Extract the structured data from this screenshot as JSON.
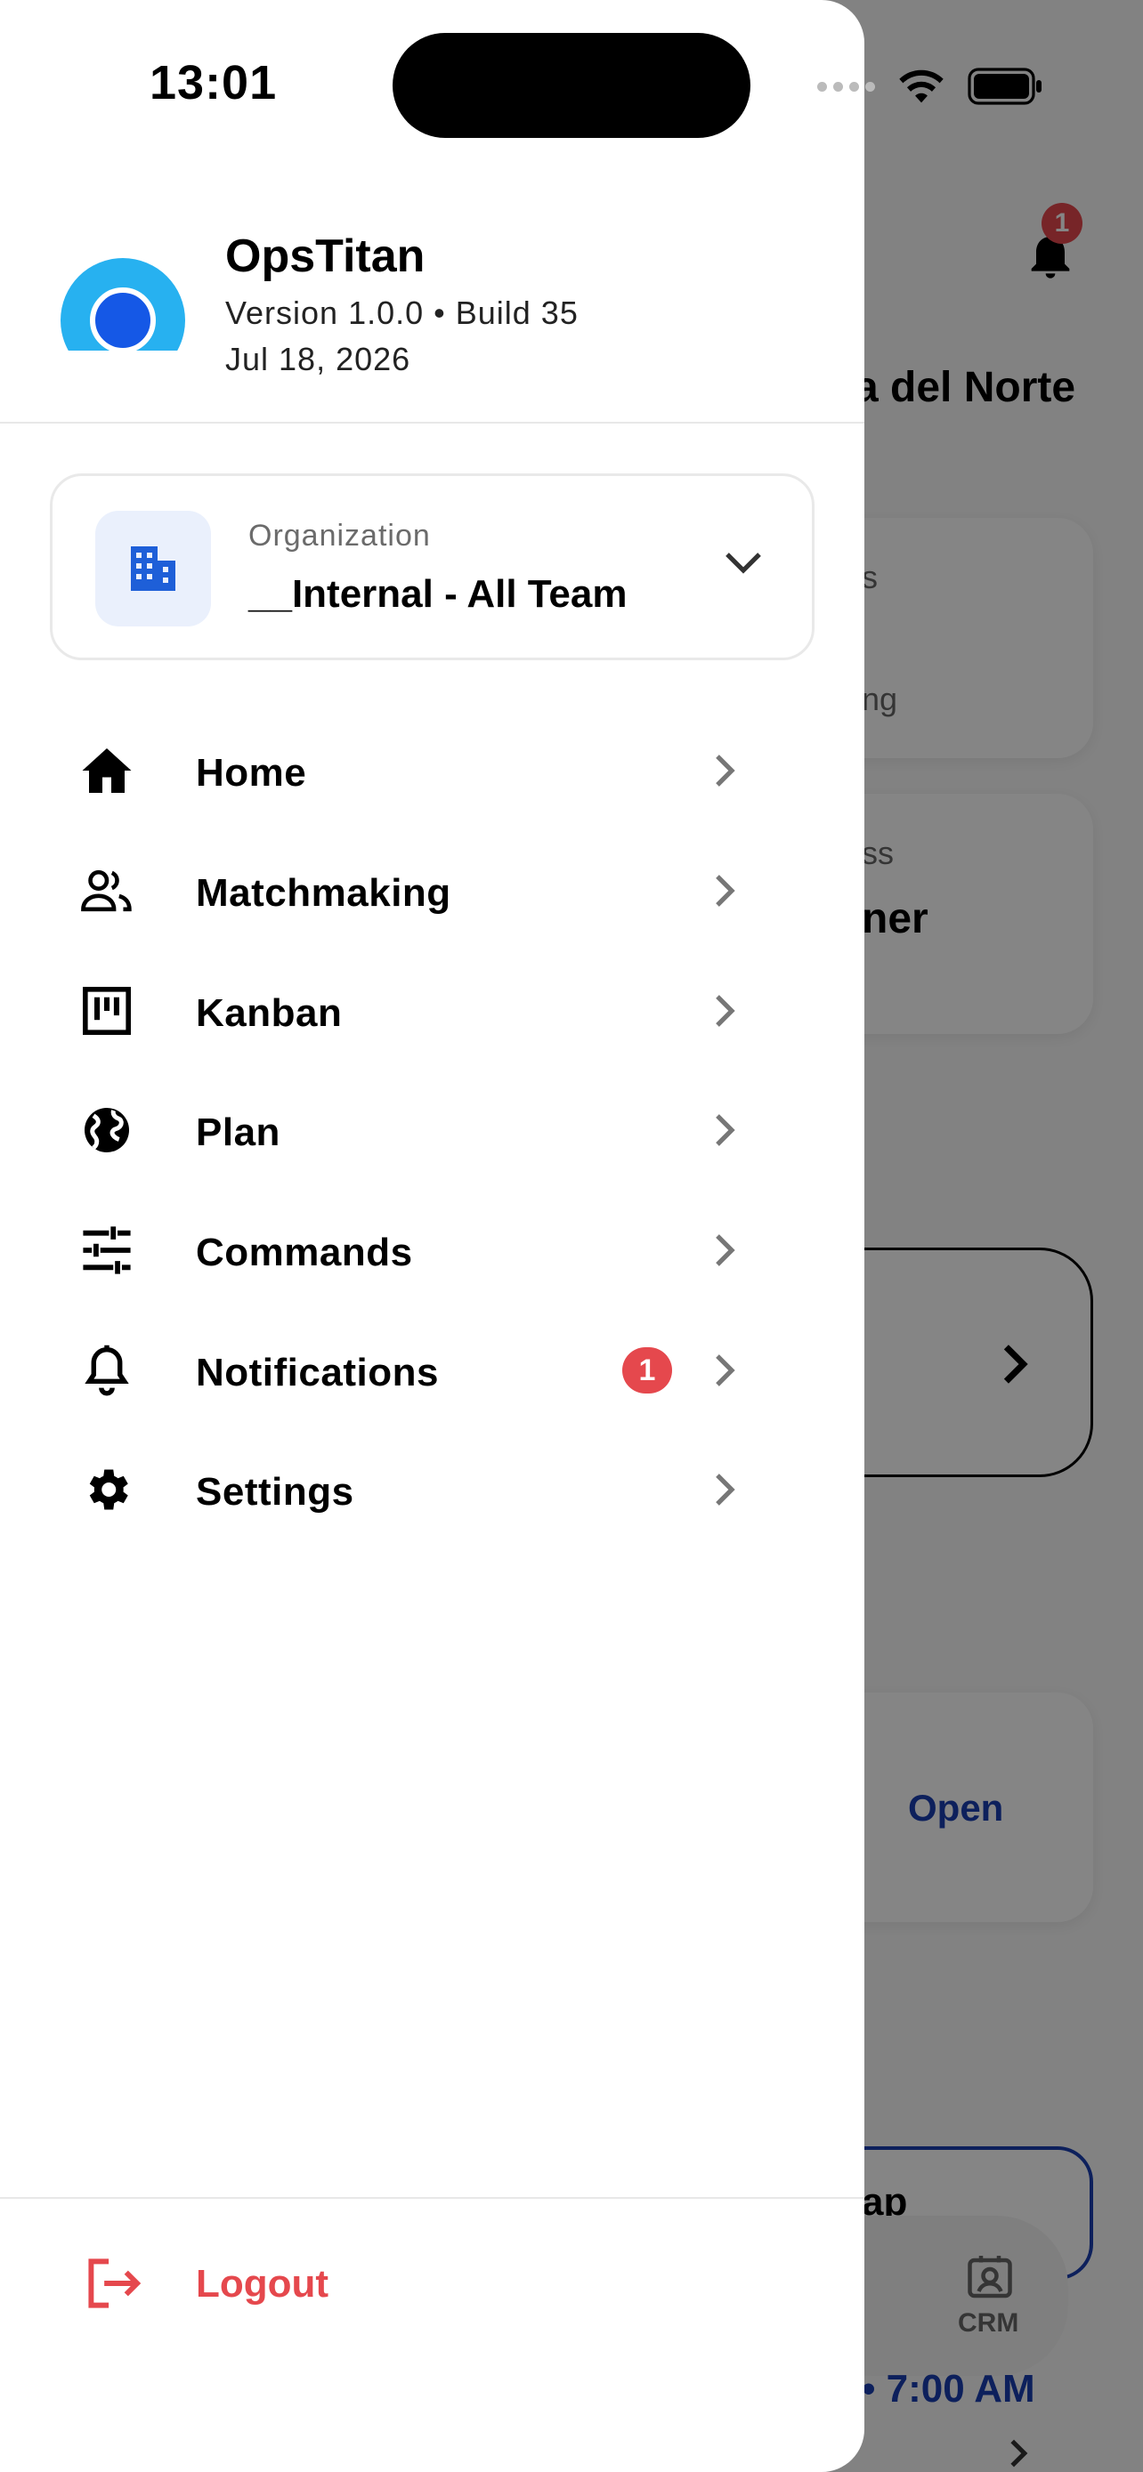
{
  "status_bar": {
    "time": "13:01"
  },
  "app": {
    "name": "OpsTitan",
    "version": "Version 1.0.0 • Build 35",
    "date": "Jul 18, 2026"
  },
  "organization": {
    "label": "Organization",
    "value": "__Internal - All Team"
  },
  "menu": [
    {
      "label": "Home",
      "icon": "home-icon"
    },
    {
      "label": "Matchmaking",
      "icon": "people-icon"
    },
    {
      "label": "Kanban",
      "icon": "kanban-icon"
    },
    {
      "label": "Plan",
      "icon": "globe-icon"
    },
    {
      "label": "Commands",
      "icon": "sliders-icon"
    },
    {
      "label": "Notifications",
      "icon": "bell-icon",
      "badge": "1"
    },
    {
      "label": "Settings",
      "icon": "gear-icon"
    }
  ],
  "logout": {
    "label": "Logout"
  },
  "background": {
    "notification_badge": "1",
    "title_fragment": "a del Norte",
    "card1_label": "s",
    "card1_sub": "ng",
    "card2_label": "ss",
    "card2_value": "ner",
    "open_link": "Open",
    "card3_fragment": "ap",
    "time_fragment": "• 7:00 AM",
    "tab_crm": "CRM"
  },
  "colors": {
    "accent_blue": "#1558e6",
    "logo_ring": "#27b1f0",
    "danger": "#e5484d",
    "scrim": "rgba(0,0,0,0.48)"
  }
}
